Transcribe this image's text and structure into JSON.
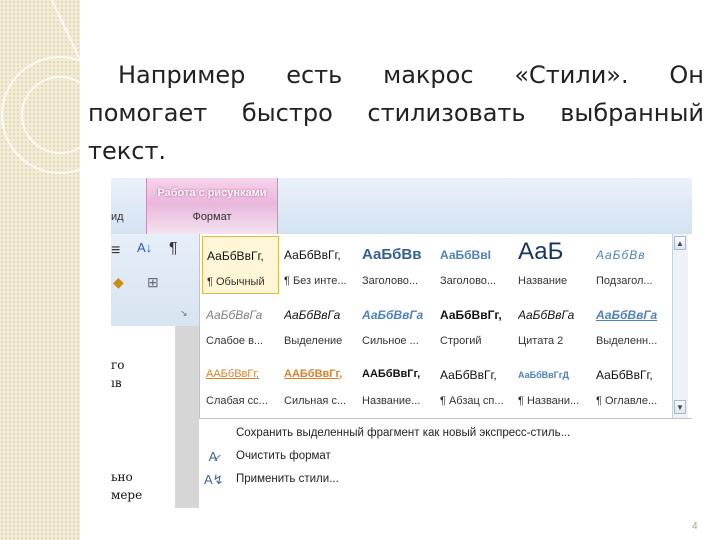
{
  "slide": {
    "paragraph_lines": [
      "Например есть макрос «Стили». Он",
      "помогает быстро стилизовать выбранный",
      "текст."
    ],
    "page_number": "4"
  },
  "ribbon": {
    "context_tab_title": "Работа с рисунками",
    "context_tab_subtitle": "Формат",
    "view_tab_fragment": "ид"
  },
  "toolbar": {
    "sort_glyph": "↓",
    "pilcrow_glyph": "¶"
  },
  "document_fragments": [
    "го",
    "ıв",
    "ьно",
    "мере"
  ],
  "styles_gallery": {
    "rows": [
      [
        {
          "sample": "АаБбВвГг,",
          "label": "¶ Обычный",
          "selected": true
        },
        {
          "sample": "АаБбВвГг,",
          "label": "¶ Без инте..."
        },
        {
          "sample": "АаБбВв",
          "label": "Заголово..."
        },
        {
          "sample": "АаБбВвІ",
          "label": "Заголово..."
        },
        {
          "sample": "АаБ",
          "label": "Название"
        },
        {
          "sample": "АаБбВв",
          "label": "Подзагол..."
        }
      ],
      [
        {
          "sample": "АаБбВвГа",
          "label": "Слабое в..."
        },
        {
          "sample": "АаБбВвГа",
          "label": "Выделение"
        },
        {
          "sample": "АаБбВвГа",
          "label": "Сильное ..."
        },
        {
          "sample": "АаБбВвГг,",
          "label": "Строгий"
        },
        {
          "sample": "АаБбВвГа",
          "label": "Цитата 2"
        },
        {
          "sample": "АаБбВвГа",
          "label": "Выделенн..."
        }
      ],
      [
        {
          "sample": "ААБбВвГг,",
          "label": "Слабая сс..."
        },
        {
          "sample": "ААБбВвГг,",
          "label": "Сильная с..."
        },
        {
          "sample": "ААБбВвГг,",
          "label": "Название..."
        },
        {
          "sample": "АаБбВвГг,",
          "label": "¶ Абзац сп..."
        },
        {
          "sample": "АаБбВвГгД",
          "label": "¶ Названи..."
        },
        {
          "sample": "АаБбВвГг,",
          "label": "¶ Оглавле..."
        }
      ]
    ]
  },
  "styles_menu": {
    "save_selection": "Сохранить выделенный фрагмент как новый экспресс-стиль...",
    "clear_formatting": "Очистить формат",
    "apply_styles": "Применить стили..."
  },
  "colors": {
    "accent_blue": "#366092",
    "context_pink": "#e9b6dc",
    "selection_gold": "#e7b64b",
    "orange_style": "#d9812c"
  }
}
